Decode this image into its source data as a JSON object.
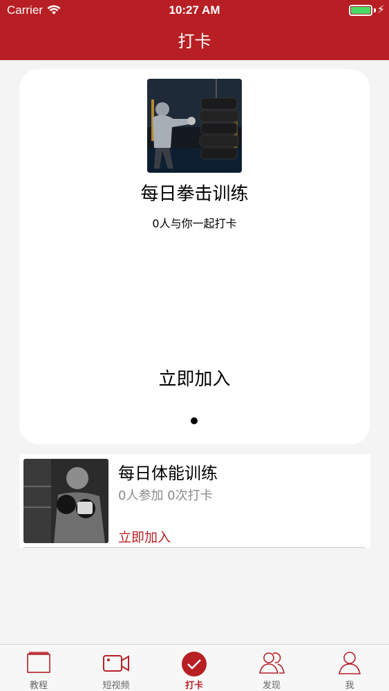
{
  "status_bar": {
    "carrier": "Carrier",
    "time": "10:27 AM"
  },
  "nav": {
    "title": "打卡"
  },
  "featured": {
    "title": "每日拳击训练",
    "subtitle": "0人与你一起打卡",
    "join_label": "立即加入",
    "image_icon": "boxing-training-photo"
  },
  "list": [
    {
      "title": "每日体能训练",
      "stats": "0人参加 0次打卡",
      "join_label": "立即加入",
      "image_icon": "fitness-boxer-photo"
    }
  ],
  "tabs": [
    {
      "label": "教程",
      "icon": "book-icon"
    },
    {
      "label": "短视频",
      "icon": "video-camera-icon"
    },
    {
      "label": "打卡",
      "icon": "checkmark-icon",
      "active": true
    },
    {
      "label": "发现",
      "icon": "people-icon"
    },
    {
      "label": "我",
      "icon": "person-icon"
    }
  ],
  "colors": {
    "brand": "#b71f24",
    "battery": "#4cd964",
    "inactive": "#666666"
  }
}
